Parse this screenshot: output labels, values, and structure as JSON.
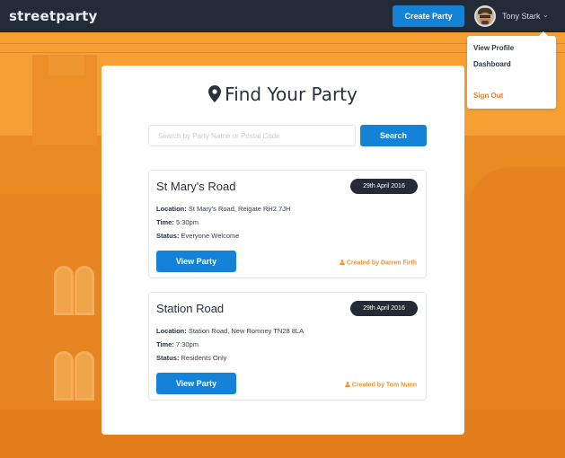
{
  "navbar": {
    "brand": "streetparty",
    "create_party_label": "Create Party",
    "user_name": "Tony Stark",
    "dropdown_icon": "chevron-down-icon"
  },
  "user_menu": {
    "items": [
      {
        "label": "View Profile"
      },
      {
        "label": "Dashboard"
      },
      {
        "label": "Sign Out"
      }
    ]
  },
  "main": {
    "title": "Find Your Party",
    "title_icon": "map-marker-icon",
    "search": {
      "placeholder": "Search by Party Name or Postal Code",
      "value": "",
      "button_label": "Search"
    },
    "parties": [
      {
        "name": "St Mary's Road",
        "date": "29th April 2016",
        "location_label": "Location:",
        "location": "St Mary's Road, Reigate RH2 7JH",
        "time_label": "Time:",
        "time": "5:30pm",
        "status_label": "Status:",
        "status": "Everyone Welcome",
        "view_label": "View Party",
        "created_by": "Created by Darren Firth"
      },
      {
        "name": "Station Road",
        "date": "29th April 2016",
        "location_label": "Location:",
        "location": "Station Road, New Romney TN28 8LA",
        "time_label": "Time:",
        "time": "7:30pm",
        "status_label": "Status:",
        "status": "Residents Only",
        "view_label": "View Party",
        "created_by": "Created by Tom Nunn"
      }
    ]
  },
  "colors": {
    "navbar": "#232b37",
    "primary": "#1482d6",
    "accent_orange": "#f5922a",
    "sign_out": "#f47a2a",
    "background_overlay": "#f39a2a"
  }
}
